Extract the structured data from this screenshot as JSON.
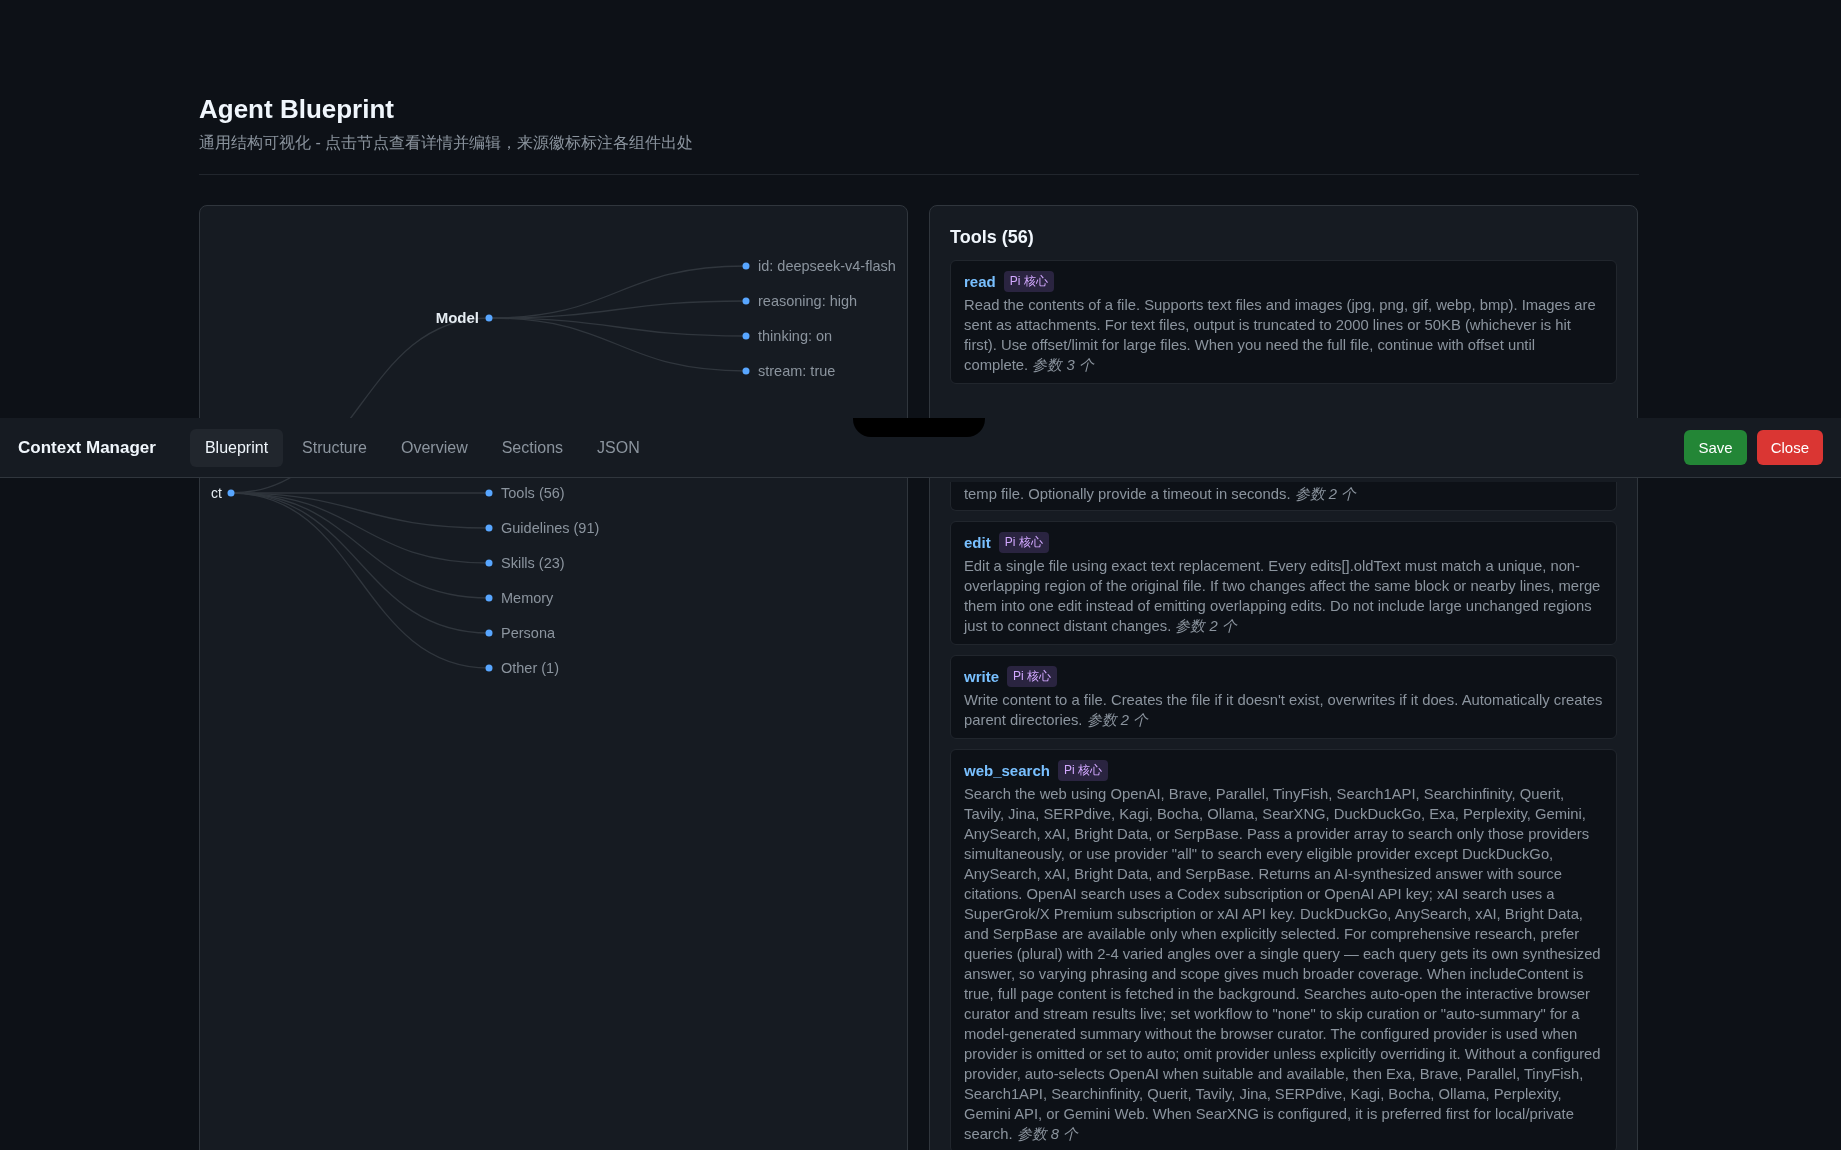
{
  "header": {
    "title": "Agent Blueprint",
    "subtitle": "通用结构可视化 - 点击节点查看详情并编辑，来源徽标标注各组件出处"
  },
  "blueprint": {
    "model": {
      "label": "Model",
      "children": [
        {
          "label": "id: deepseek-v4-flash"
        },
        {
          "label": "reasoning: high"
        },
        {
          "label": "thinking: on"
        },
        {
          "label": "stream: true"
        }
      ]
    },
    "root": {
      "label": "ct",
      "children": [
        {
          "label": "Tools (56)"
        },
        {
          "label": "Guidelines (91)"
        },
        {
          "label": "Skills (23)"
        },
        {
          "label": "Memory"
        },
        {
          "label": "Persona"
        },
        {
          "label": "Other (1)"
        }
      ]
    }
  },
  "tools_panel": {
    "title": "Tools (56)",
    "tools": [
      {
        "kind": "full",
        "name": "read",
        "badge": "Pi 核心",
        "description": "Read the contents of a file. Supports text files and images (jpg, png, gif, webp, bmp). Images are sent as attachments. For text files, output is truncated to 2000 lines or 50KB (whichever is hit first). Use offset/limit for large files. When you need the full file, continue with offset until complete. *参数 3 个*"
      },
      {
        "kind": "partial",
        "description": "temp file. Optionally provide a timeout in seconds. *参数 2 个*"
      },
      {
        "kind": "full",
        "name": "edit",
        "badge": "Pi 核心",
        "description": "Edit a single file using exact text replacement. Every edits[].oldText must match a unique, non-overlapping region of the original file. If two changes affect the same block or nearby lines, merge them into one edit instead of emitting overlapping edits. Do not include large unchanged regions just to connect distant changes. *参数 2 个*"
      },
      {
        "kind": "full",
        "name": "write",
        "badge": "Pi 核心",
        "description": "Write content to a file. Creates the file if it doesn't exist, overwrites if it does. Automatically creates parent directories. *参数 2 个*"
      },
      {
        "kind": "full",
        "name": "web_search",
        "badge": "Pi 核心",
        "description": "Search the web using OpenAI, Brave, Parallel, TinyFish, Search1API, Searchinfinity, Querit, Tavily, Jina, SERPdive, Kagi, Bocha, Ollama, SearXNG, DuckDuckGo, Exa, Perplexity, Gemini, AnySearch, xAI, Bright Data, or SerpBase. Pass a provider array to search only those providers simultaneously, or use provider \"all\" to search every eligible provider except DuckDuckGo, AnySearch, xAI, Bright Data, and SerpBase. Returns an AI-synthesized answer with source citations. OpenAI search uses a Codex subscription or OpenAI API key; xAI search uses a SuperGrok/X Premium subscription or xAI API key. DuckDuckGo, AnySearch, xAI, Bright Data, and SerpBase are available only when explicitly selected. For comprehensive research, prefer queries (plural) with 2-4 varied angles over a single query — each query gets its own synthesized answer, so varying phrasing and scope gives much broader coverage. When includeContent is true, full page content is fetched in the background. Searches auto-open the interactive browser curator and stream results live; set workflow to \"none\" to skip curation or \"auto-summary\" for a model-generated summary without the browser curator. The configured provider is used when provider is omitted or set to auto; omit provider unless explicitly overriding it. Without a configured provider, auto-selects OpenAI when suitable and available, then Exa, Brave, Parallel, TinyFish, Search1API, Searchinfinity, Querit, Tavily, Jina, SERPdive, Kagi, Bocha, Ollama, Perplexity, Gemini API, or Gemini Web. When SearXNG is configured, it is preferred first for local/private search. *参数 8 个*"
      }
    ]
  },
  "toolbar": {
    "title": "Context Manager",
    "tabs": [
      {
        "label": "Blueprint",
        "selected": true
      },
      {
        "label": "Structure",
        "selected": false
      },
      {
        "label": "Overview",
        "selected": false
      },
      {
        "label": "Sections",
        "selected": false
      },
      {
        "label": "JSON",
        "selected": false
      }
    ],
    "buttons": [
      {
        "label": "Save",
        "kind": "primary"
      },
      {
        "label": "Close",
        "kind": "danger"
      }
    ]
  }
}
